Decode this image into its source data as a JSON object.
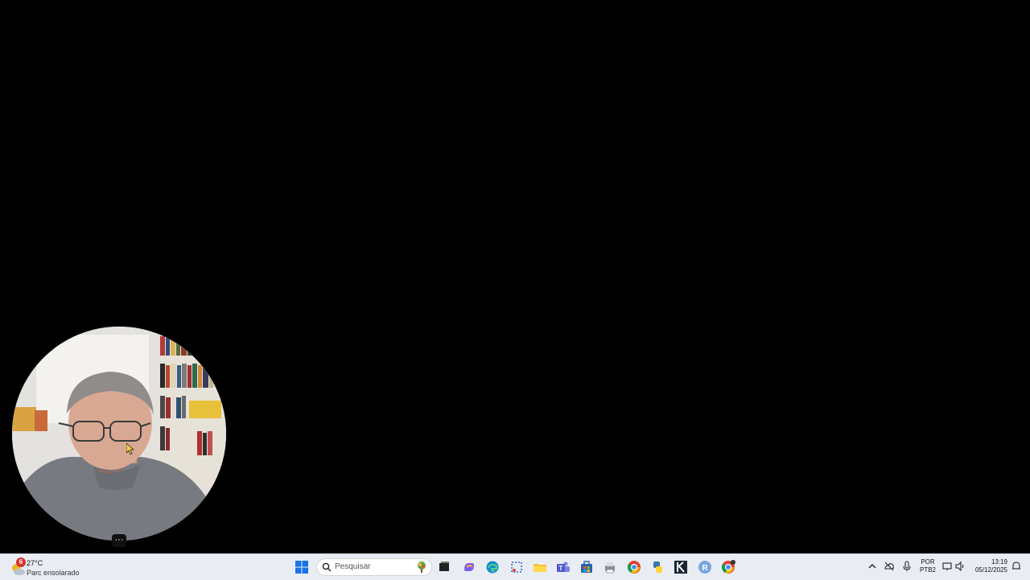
{
  "webcam": {
    "menu_label": "···"
  },
  "weather": {
    "badge": "6",
    "temperature": "27°C",
    "condition": "Parc ensolarado"
  },
  "search": {
    "placeholder": "Pesquisar"
  },
  "taskbar_icons": [
    "windows-start-icon",
    "task-view-icon",
    "copilot-icon",
    "edge-icon",
    "snipping-tool-icon",
    "file-explorer-icon",
    "teams-icon",
    "microsoft-store-icon",
    "printer-icon",
    "chrome-icon",
    "python-icon",
    "klogo-icon",
    "r-icon",
    "chrome-profile-icon"
  ],
  "tray": {
    "language_line1": "POR",
    "language_line2": "PTB2",
    "time": "13:19",
    "date": "05/12/2025"
  },
  "colors": {
    "taskbar_bg": "#e9edf3",
    "desktop_bg": "#000000"
  }
}
